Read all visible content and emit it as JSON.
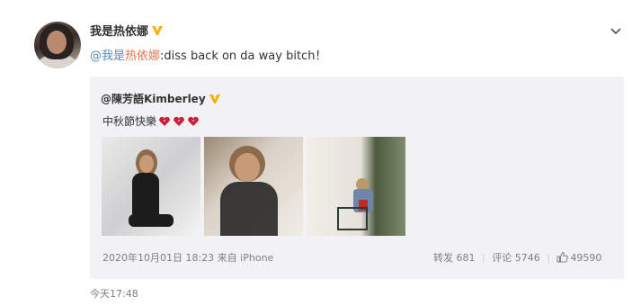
{
  "post": {
    "username": "我是热依娜",
    "text_mention_prefix": "@我是",
    "text_mention_name": "热依娜",
    "text_body": ":diss back on da way bitch！",
    "time": "今天17:48"
  },
  "repost": {
    "username": "@陳芳語Kimberley",
    "text": "中秋節快樂",
    "date": "2020年10月01日 18:23 来自 iPhone",
    "forward_label": "转发 681",
    "comment_label": "评论 5746",
    "like_count": "49590"
  },
  "icons": {
    "verified": "verified-badge-icon",
    "menu": "chevron-down-icon",
    "heart": "heart-icon",
    "like": "thumbs-up-icon"
  },
  "colors": {
    "verified": "#f6b011",
    "mention_orange": "#eb7350",
    "mention_blue": "#5a8ab6",
    "heart": "#c8223a",
    "repost_bg": "#f2f2f5"
  }
}
